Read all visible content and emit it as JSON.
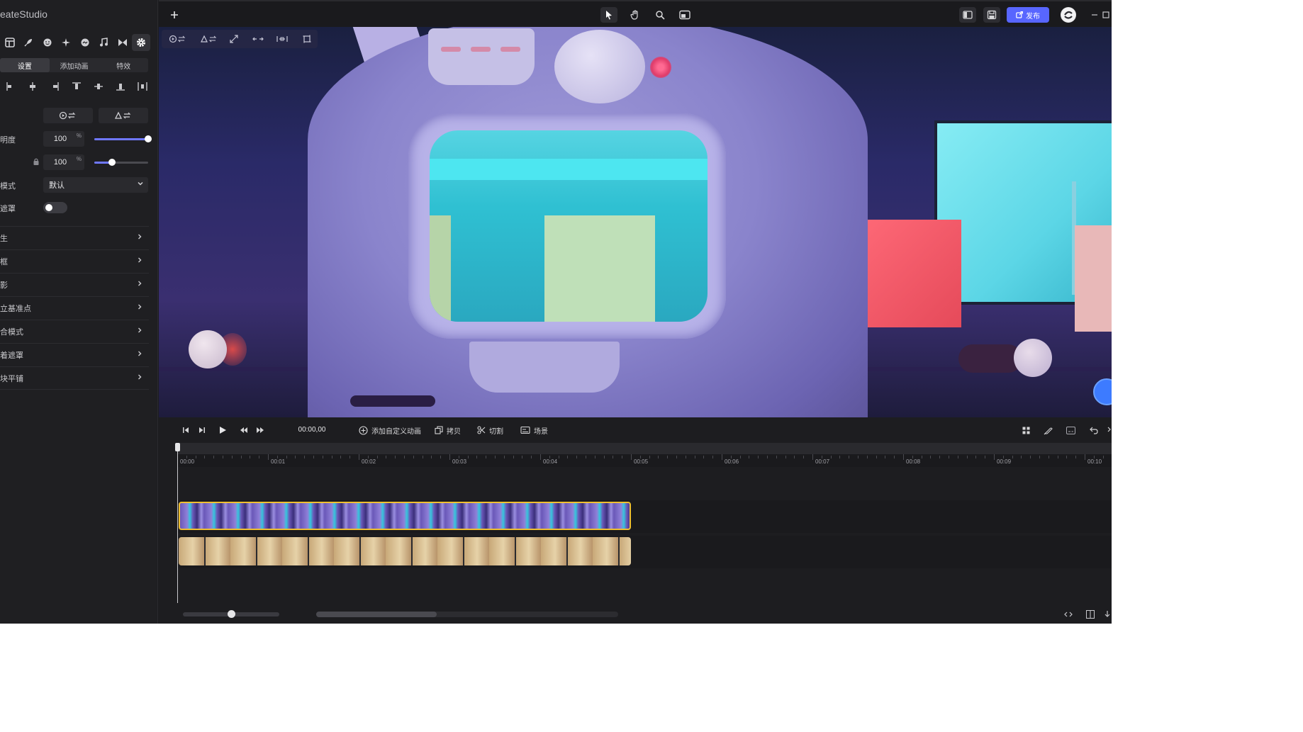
{
  "app": {
    "brand": "eateStudio"
  },
  "left_panel": {
    "tabs": [
      {
        "label": "设置",
        "active": true
      },
      {
        "label": "添加动画",
        "active": false
      },
      {
        "label": "特效",
        "active": false
      }
    ],
    "props": {
      "opacity_label": "明度",
      "opacity_value": "100",
      "opacity_unit": "%",
      "opacity_level": 1.0,
      "scale_label": "",
      "scale_value": "100",
      "scale_unit": "%",
      "scale_level": 0.33,
      "blend_label": "模式",
      "blend_value": "默认",
      "mask_label": "遮罩",
      "mask_on": false
    },
    "sections": [
      {
        "label": "生"
      },
      {
        "label": "框"
      },
      {
        "label": "影"
      },
      {
        "label": "立基准点"
      },
      {
        "label": "合模式"
      },
      {
        "label": "着遮罩"
      },
      {
        "label": "块平铺"
      }
    ]
  },
  "topbar": {
    "publish_label": "发布",
    "accent": "#5866ff"
  },
  "timeline": {
    "timecode": "00:00,00",
    "add_anim_label": "添加自定义动画",
    "copy_label": "拷贝",
    "cut_label": "切割",
    "scene_label": "场景",
    "ruler_labels": [
      "00:00",
      "00:01",
      "00:02",
      "00:03",
      "00:04",
      "00:05",
      "00:06",
      "00:07",
      "00:08",
      "00:09",
      "00:10"
    ],
    "clip_border": "#f0c030",
    "zoom_level": 0.5,
    "scroll_fraction": 0.4
  }
}
